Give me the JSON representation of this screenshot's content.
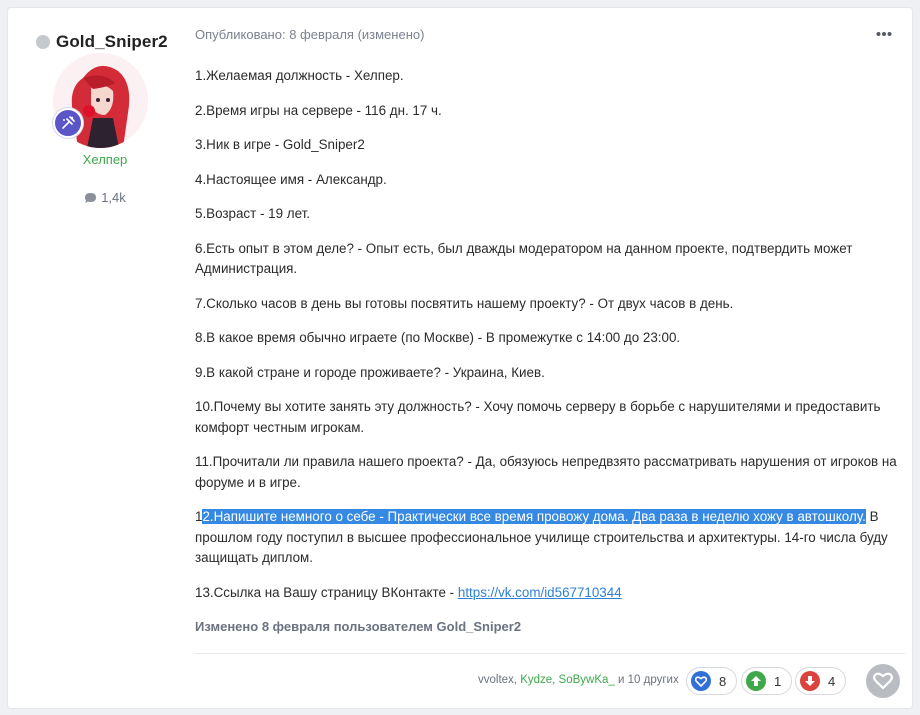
{
  "author": {
    "name": "Gold_Sniper2",
    "group": "Хелпер",
    "posts_count": "1,4k",
    "online": false
  },
  "post": {
    "meta": "Опубликовано: 8 февраля (изменено)",
    "lines": [
      "1.Желаемая должность - Хелпер.",
      "2.Время игры на сервере - 116 дн. 17 ч.",
      "3.Ник в игре - Gold_Sniper2",
      "4.Настоящее имя - Александр.",
      "5.Возраст - 19 лет.",
      "6.Есть опыт в этом деле? - Опыт есть, был дважды модератором на данном проекте, подтвердить может Администрация.",
      "7.Сколько часов в день вы готовы посвятить нашему проекту? - От двух часов в день.",
      "8.В какое время обычно играете (по Москве) - В промежутке с 14:00 до 23:00.",
      "9.В какой стране и городе проживаете? - Украина, Киев.",
      "10.Почему вы хотите занять эту должность? - Хочу помочь серверу в борьбе с нарушителями и предоставить комфорт честным игрокам.",
      "11.Прочитали ли правила нашего проекта? - Да, обязуюсь непредвзято рассматривать нарушения от игроков на форуме и в игре."
    ],
    "line12": {
      "prefix": "1",
      "highlighted": "2.Напишите немного о себе - Практически все время провожу дома. Два раза в неделю хожу в автошколу.",
      "rest": " В прошлом году поступил в высшее профессиональное училище строительства и архитектуры. 14-го числа буду защищать диплом."
    },
    "line13": {
      "text": "13.Ссылка на Вашу страницу ВКонтакте - ",
      "link": "https://vk.com/id567710344"
    },
    "edited_note": "Изменено 8 февраля пользователем Gold_Sniper2"
  },
  "reactions": {
    "users": [
      "vvoltex",
      "Kydze",
      "SoBywKa_"
    ],
    "separator": ", ",
    "others": " и 10 других",
    "items": [
      {
        "icon": "heart-icon",
        "count": "8",
        "color": "#2f6fd6"
      },
      {
        "icon": "arrow-up-icon",
        "count": "1",
        "color": "#3ea84a"
      },
      {
        "icon": "arrow-down-icon",
        "count": "4",
        "color": "#d9443c"
      }
    ]
  },
  "colors": {
    "accent": "#3589e3",
    "group_green": "#3ea84a"
  }
}
